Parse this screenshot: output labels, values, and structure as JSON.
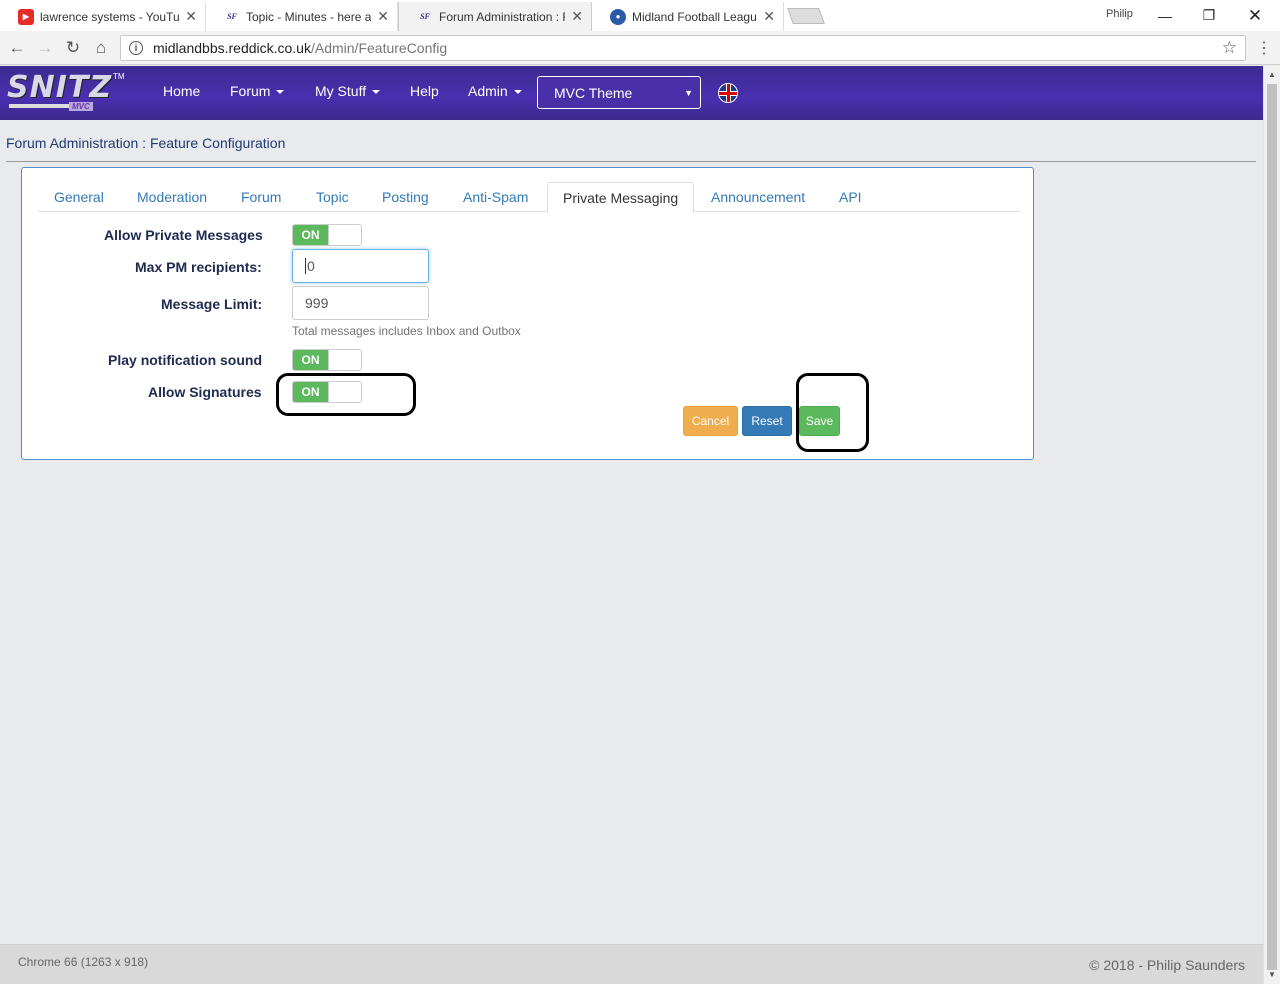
{
  "browser": {
    "tabs": [
      {
        "title": "lawrence systems - YouTu",
        "icon": "youtube-icon"
      },
      {
        "title": "Topic - Minutes - here an",
        "icon": "snitz-icon"
      },
      {
        "title": "Forum Administration : Fe",
        "icon": "snitz-icon"
      },
      {
        "title": "Midland Football League",
        "icon": "mfl-icon"
      }
    ],
    "profile": "Philip",
    "url_host": "midlandbbs.reddick.co.uk",
    "url_path": "/Admin/FeatureConfig"
  },
  "site": {
    "logo_text": "SNITZ",
    "logo_tm": "TM",
    "logo_sub": "MVC",
    "nav": [
      "Home",
      "Forum",
      "My Stuff",
      "Help",
      "Admin"
    ],
    "theme_selected": "MVC Theme",
    "flag_icon": "uk-flag-icon"
  },
  "breadcrumb": "Forum Administration : Feature Configuration",
  "panel": {
    "tabs": [
      "General",
      "Moderation",
      "Forum",
      "Topic",
      "Posting",
      "Anti-Spam",
      "Private Messaging",
      "Announcement",
      "API"
    ],
    "active_tab": "Private Messaging",
    "fields": {
      "allow_pm_label": "Allow Private Messages",
      "allow_pm_state": "ON",
      "max_recipients_label": "Max PM recipients:",
      "max_recipients_value": "0",
      "message_limit_label": "Message Limit:",
      "message_limit_value": "999",
      "message_limit_help": "Total messages includes Inbox and Outbox",
      "notify_sound_label": "Play notification sound",
      "notify_sound_state": "ON",
      "allow_sig_label": "Allow Signatures",
      "allow_sig_state": "ON"
    },
    "buttons": {
      "cancel": "Cancel",
      "reset": "Reset",
      "save": "Save"
    }
  },
  "footer": {
    "left": "Chrome 66 (1263 x 918)",
    "right": "© 2018 - Philip Saunders"
  },
  "colors": {
    "nav_bg": "#3b2b8f",
    "toggle_on": "#5cb85c",
    "cancel": "#f0ad4e",
    "reset": "#337ab7",
    "save": "#5cb85c",
    "link": "#337ab7"
  }
}
